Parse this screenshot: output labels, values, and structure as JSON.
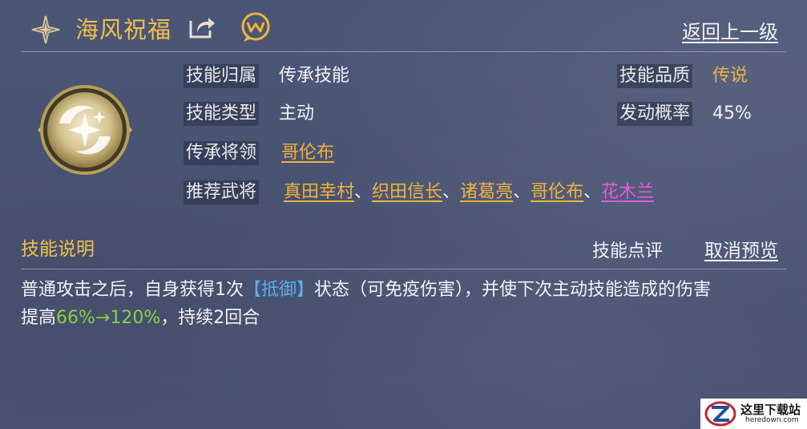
{
  "header": {
    "title": "海风祝福",
    "back_label": "返回上一级",
    "icons": {
      "star": "four-point-star-icon",
      "share": "share-icon",
      "chat": "chat-bubble-icon"
    }
  },
  "skill": {
    "emblem_icon": "skill-emblem-icon",
    "rows": {
      "affiliation": {
        "label": "技能归属",
        "value": "传承技能"
      },
      "type": {
        "label": "技能类型",
        "value": "主动"
      },
      "inherit_general": {
        "label": "传承将领",
        "value": "哥伦布"
      },
      "recommend": {
        "label": "推荐武将",
        "generals": [
          "真田幸村",
          "织田信长",
          "诸葛亮",
          "哥伦布",
          "花木兰"
        ],
        "separator": "、"
      },
      "quality": {
        "label": "技能品质",
        "value": "传说"
      },
      "trigger_rate": {
        "label": "发动概率",
        "value": "45%"
      }
    }
  },
  "description": {
    "section_title": "技能说明",
    "review_label": "技能点评",
    "cancel_preview_label": "取消预览",
    "line1_a": "普通攻击之后，自身获得1次",
    "keyword": "【抵御】",
    "line1_b": "状态（可免疫伤害），并使下次主动技能造成的伤害",
    "line2_a": "提高",
    "value_from": "66%",
    "arrow": "→",
    "value_to": "120%",
    "line2_b": "，持续2回合"
  },
  "watermark": {
    "cn": "这里下载站",
    "en": "heredown.com"
  },
  "colors": {
    "gold": "#f0b33c",
    "pink": "#e35ad6",
    "keyword": "#5aaee8",
    "green": "#86d33e"
  }
}
